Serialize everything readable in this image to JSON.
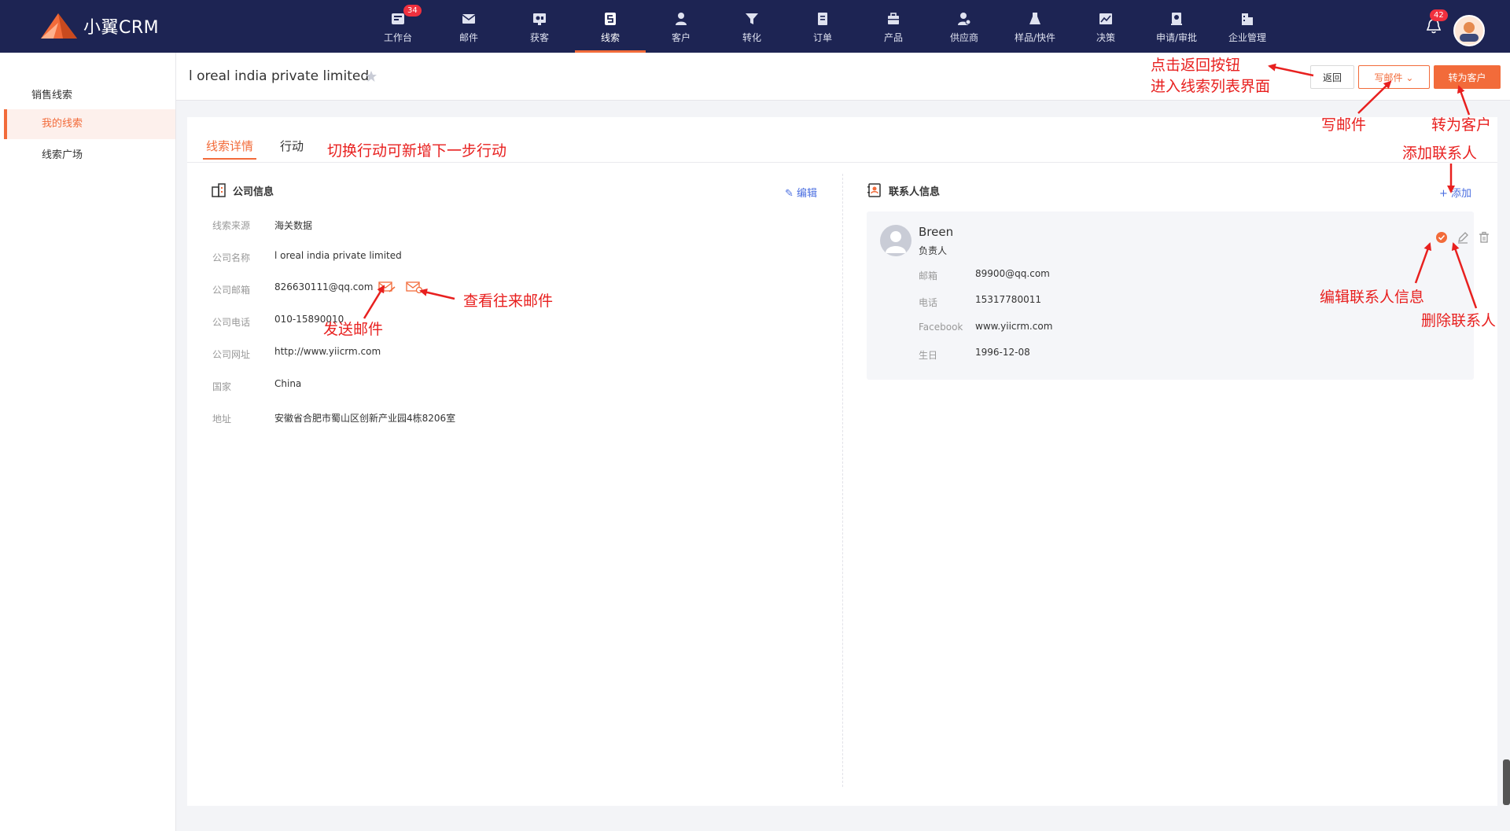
{
  "app": {
    "logo_text": "小翼CRM"
  },
  "nav": [
    {
      "label": "工作台",
      "icon": "workbench-icon",
      "badge": "34"
    },
    {
      "label": "邮件",
      "icon": "mail-icon"
    },
    {
      "label": "获客",
      "icon": "acquire-icon"
    },
    {
      "label": "线索",
      "icon": "lead-icon",
      "active": true
    },
    {
      "label": "客户",
      "icon": "customer-icon"
    },
    {
      "label": "转化",
      "icon": "funnel-icon"
    },
    {
      "label": "订单",
      "icon": "order-icon"
    },
    {
      "label": "产品",
      "icon": "product-icon"
    },
    {
      "label": "供应商",
      "icon": "supplier-icon"
    },
    {
      "label": "样品/快件",
      "icon": "sample-icon"
    },
    {
      "label": "决策",
      "icon": "decision-icon"
    },
    {
      "label": "申请/审批",
      "icon": "approval-icon"
    },
    {
      "label": "企业管理",
      "icon": "enterprise-icon"
    }
  ],
  "notifications": {
    "badge": "42"
  },
  "sidebar": {
    "title": "销售线索",
    "items": [
      {
        "label": "我的线索",
        "active": true
      },
      {
        "label": "线索广场"
      }
    ]
  },
  "header": {
    "title": "l oreal india private limited",
    "back_label": "返回",
    "write_mail_label": "写邮件",
    "convert_label": "转为客户"
  },
  "tabs": [
    {
      "label": "线索详情",
      "active": true
    },
    {
      "label": "行动"
    }
  ],
  "company": {
    "section_title": "公司信息",
    "edit_label": "编辑",
    "fields": [
      {
        "label": "线索来源",
        "value": "海关数据"
      },
      {
        "label": "公司名称",
        "value": "l oreal india private limited"
      },
      {
        "label": "公司邮箱",
        "value": "826630111@qq.com"
      },
      {
        "label": "公司电话",
        "value": "010-15890010"
      },
      {
        "label": "公司网址",
        "value": "http://www.yiicrm.com"
      },
      {
        "label": "国家",
        "value": "China"
      },
      {
        "label": "地址",
        "value": "安徽省合肥市蜀山区创新产业园4栋8206室"
      }
    ]
  },
  "contacts": {
    "section_title": "联系人信息",
    "add_label": "+ 添加",
    "items": [
      {
        "name": "Breen",
        "role": "负责人",
        "fields": [
          {
            "label": "邮箱",
            "value": "89900@qq.com"
          },
          {
            "label": "电话",
            "value": "15317780011"
          },
          {
            "label": "Facebook",
            "value": "www.yiicrm.com"
          },
          {
            "label": "生日",
            "value": "1996-12-08"
          }
        ]
      }
    ]
  },
  "annotations": {
    "back_line1": "点击返回按钮",
    "back_line2": "进入线索列表界面",
    "write_mail": "写邮件",
    "convert": "转为客户",
    "add_contact": "添加联系人",
    "switch_action": "切换行动可新增下一步行动",
    "send_mail": "发送邮件",
    "view_mail": "查看往来邮件",
    "edit_contact": "编辑联系人信息",
    "delete_contact": "删除联系人"
  },
  "colors": {
    "nav_bg": "#1d2453",
    "accent": "#f26b3a",
    "annotation": "#e8201f",
    "link": "#4a6ee0"
  }
}
